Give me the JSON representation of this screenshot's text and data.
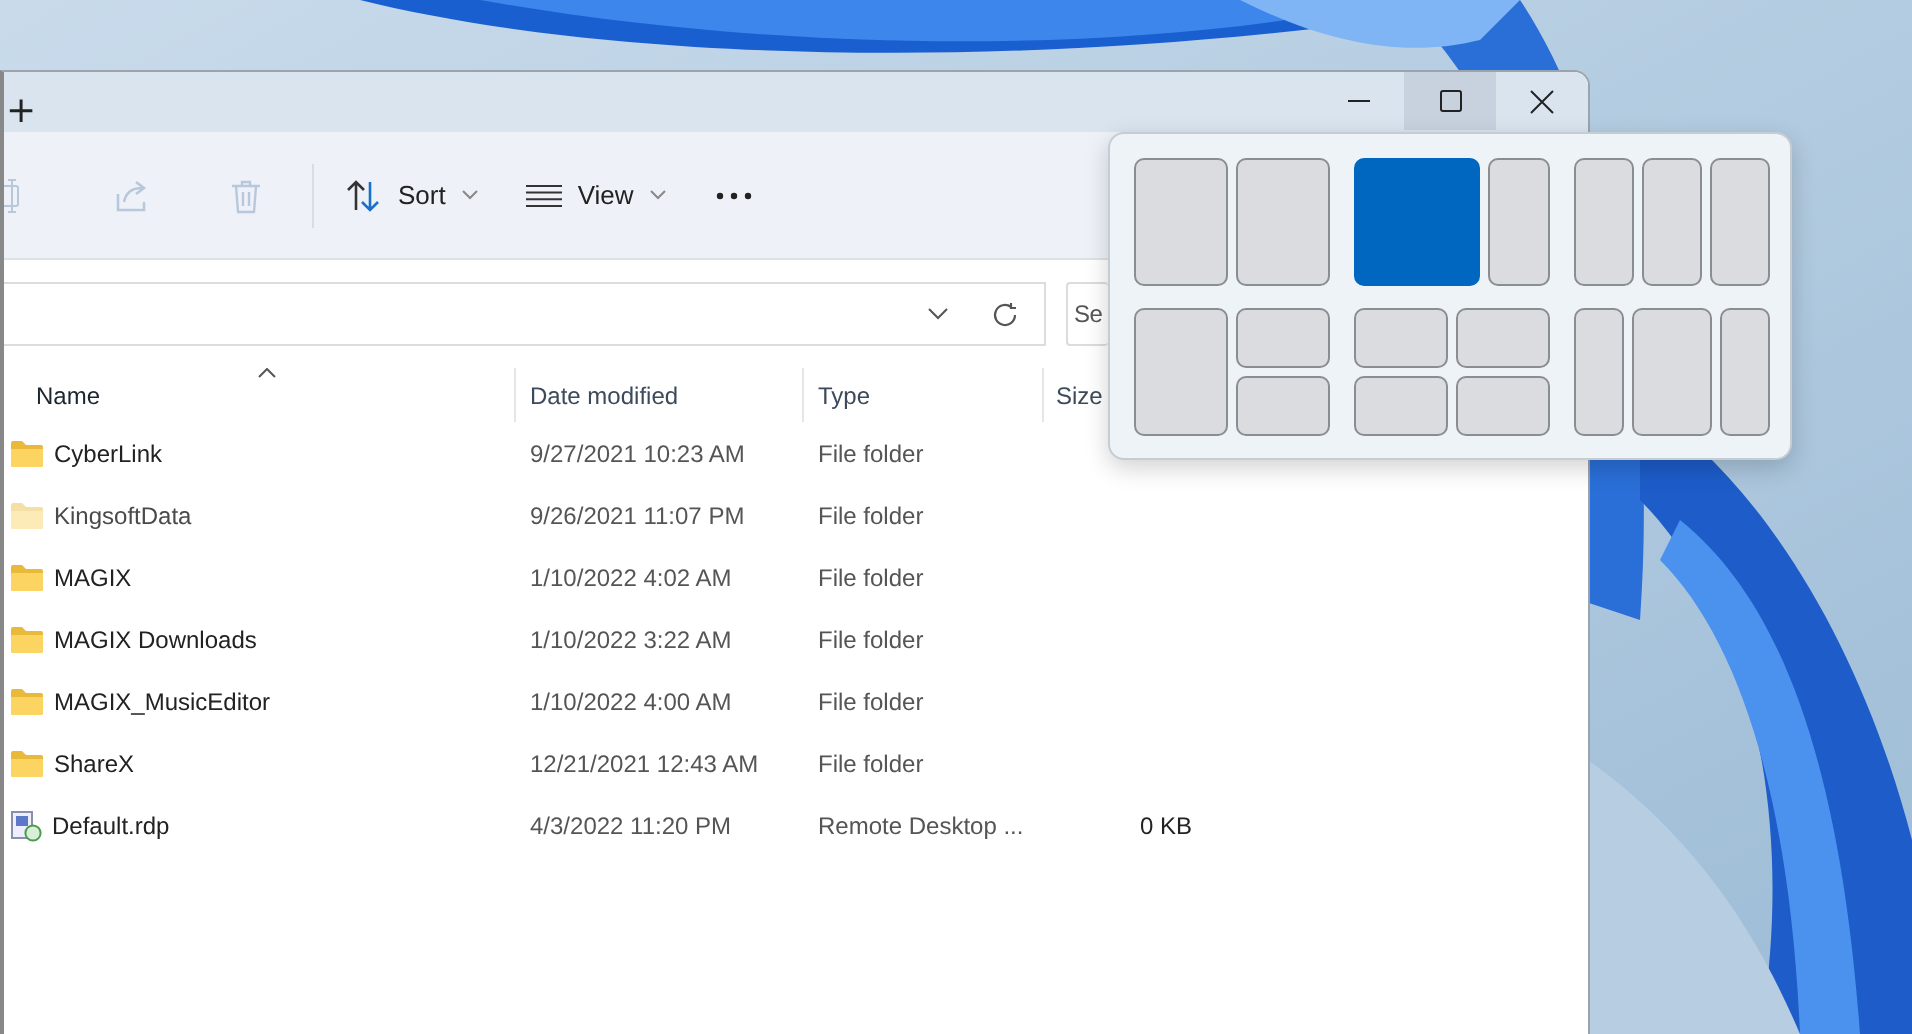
{
  "window": {
    "new_tab": "+",
    "controls": [
      {
        "kind": "minimize",
        "hovered": false
      },
      {
        "kind": "maximize",
        "hovered": true
      },
      {
        "kind": "close",
        "hovered": false
      }
    ]
  },
  "toolbar": [
    {
      "kind": "rename",
      "disabled": true
    },
    {
      "kind": "share",
      "disabled": true
    },
    {
      "kind": "delete",
      "disabled": true
    },
    {
      "kind": "sort",
      "label": "Sort",
      "disabled": false
    },
    {
      "kind": "view",
      "label": "View",
      "disabled": false
    },
    {
      "kind": "more",
      "disabled": false
    }
  ],
  "search": {
    "placeholder": "Se"
  },
  "table": {
    "columns": [
      {
        "label": "Name",
        "sorted": true
      },
      {
        "label": "Date modified",
        "sorted": false
      },
      {
        "label": "Type",
        "sorted": false
      },
      {
        "label": "Size",
        "sorted": false
      }
    ],
    "rows": [
      {
        "kind": "folder",
        "hidden": false,
        "name": "CyberLink",
        "date": "9/27/2021 10:23 AM",
        "type": "File folder"
      },
      {
        "kind": "folder",
        "hidden": true,
        "name": "KingsoftData",
        "date": "9/26/2021 11:07 PM",
        "type": "File folder"
      },
      {
        "kind": "folder",
        "hidden": false,
        "name": "MAGIX",
        "date": "1/10/2022 4:02 AM",
        "type": "File folder"
      },
      {
        "kind": "folder",
        "hidden": false,
        "name": "MAGIX Downloads",
        "date": "1/10/2022 3:22 AM",
        "type": "File folder"
      },
      {
        "kind": "folder",
        "hidden": false,
        "name": "MAGIX_MusicEditor",
        "date": "1/10/2022 4:00 AM",
        "type": "File folder"
      },
      {
        "kind": "folder",
        "hidden": false,
        "name": "ShareX",
        "date": "12/21/2021 12:43 AM",
        "type": "File folder"
      },
      {
        "kind": "rdp",
        "hidden": false,
        "name": "Default.rdp",
        "date": "4/3/2022 11:20 PM",
        "type": "Remote Desktop ...",
        "size": "0 KB"
      }
    ]
  },
  "snap_layouts": [
    {
      "kind": "halves",
      "zones": [
        {
          "selected": false
        },
        {
          "selected": false
        }
      ]
    },
    {
      "kind": "wide-left",
      "zones": [
        {
          "selected": true
        },
        {
          "selected": false
        }
      ]
    },
    {
      "kind": "thirds",
      "zones": [
        {
          "selected": false
        },
        {
          "selected": false
        },
        {
          "selected": false
        }
      ]
    },
    {
      "kind": "left-and-stack",
      "zones": [
        {
          "selected": false
        },
        {
          "selected": false
        },
        {
          "selected": false
        }
      ]
    },
    {
      "kind": "quad",
      "zones": [
        {
          "selected": false
        },
        {
          "selected": false
        },
        {
          "selected": false
        },
        {
          "selected": false
        }
      ]
    },
    {
      "kind": "wide-center",
      "zones": [
        {
          "selected": false
        },
        {
          "selected": false
        },
        {
          "selected": false
        }
      ]
    }
  ]
}
